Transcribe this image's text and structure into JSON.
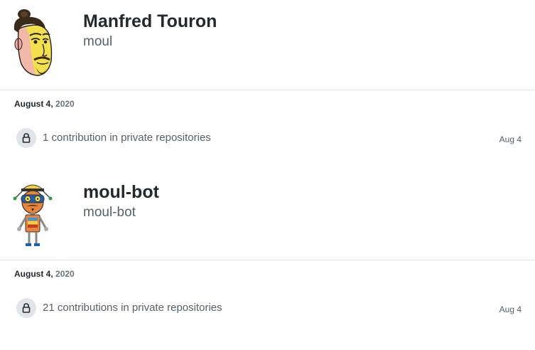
{
  "users": [
    {
      "name": "Manfred Touron",
      "login": "moul",
      "date_month_day": "August 4,",
      "date_year": "2020",
      "contribution_text": "1 contribution in private repositories",
      "relative_date": "Aug 4",
      "avatar_icon": "cartoon-man-avatar-icon"
    },
    {
      "name": "moul-bot",
      "login": "moul-bot",
      "date_month_day": "August 4,",
      "date_year": "2020",
      "contribution_text": "21 contributions in private repositories",
      "relative_date": "Aug 4",
      "avatar_icon": "robot-avatar-icon"
    }
  ],
  "colors": {
    "text_primary": "#24292e",
    "text_secondary": "#586069",
    "lock_bg": "#e1e4e8",
    "divider": "#e1e4e8"
  }
}
